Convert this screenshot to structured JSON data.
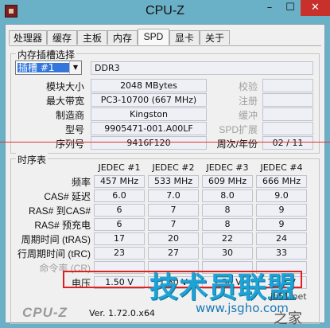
{
  "window": {
    "title": "CPU-Z",
    "min_label": "–",
    "max_label": "☐",
    "close_label": "✕"
  },
  "tabs": [
    {
      "label": "处理器"
    },
    {
      "label": "缓存"
    },
    {
      "label": "主板"
    },
    {
      "label": "内存"
    },
    {
      "label": "SPD",
      "active": true
    },
    {
      "label": "显卡"
    },
    {
      "label": "关于"
    }
  ],
  "slot_group": {
    "title": "内存插槽选择",
    "slot_select": "插槽 #1",
    "type": "DDR3",
    "rows": [
      {
        "label": "模块大小",
        "value": "2048 MBytes",
        "right_label": "校验",
        "right_value": ""
      },
      {
        "label": "最大带宽",
        "value": "PC3-10700 (667 MHz)",
        "right_label": "注册",
        "right_value": ""
      },
      {
        "label": "制造商",
        "value": "Kingston",
        "right_label": "缓冲",
        "right_value": ""
      },
      {
        "label": "型号",
        "value": "9905471-001.A00LF",
        "right_label": "SPD扩展",
        "right_value": ""
      },
      {
        "label": "序列号",
        "value": "9416F120",
        "right_label": "周次/年份",
        "right_value": "02 / 11"
      }
    ]
  },
  "timing_group": {
    "title": "时序表",
    "columns": [
      "JEDEC #1",
      "JEDEC #2",
      "JEDEC #3",
      "JEDEC #4"
    ],
    "rows": [
      {
        "label": "频率",
        "values": [
          "457 MHz",
          "533 MHz",
          "609 MHz",
          "666 MHz"
        ]
      },
      {
        "label": "CAS# 延迟",
        "values": [
          "6.0",
          "7.0",
          "8.0",
          "9.0"
        ]
      },
      {
        "label": "RAS# 到CAS#",
        "values": [
          "6",
          "7",
          "8",
          "9"
        ]
      },
      {
        "label": "RAS# 预充电",
        "values": [
          "6",
          "7",
          "8",
          "9"
        ]
      },
      {
        "label": "周期时间 (tRAS)",
        "values": [
          "17",
          "20",
          "22",
          "24"
        ]
      },
      {
        "label": "行周期时间 (tRC)",
        "values": [
          "23",
          "27",
          "30",
          "33"
        ]
      },
      {
        "label": "命令率 (CR)",
        "values": [
          "",
          "",
          "",
          ""
        ],
        "gray": true
      },
      {
        "label": "电压",
        "values": [
          "1.50 V",
          "1.50 V",
          "1.50 V",
          "1.50 V"
        ]
      }
    ]
  },
  "footer": {
    "brand": "CPU-Z",
    "version": "Ver. 1.72.0.x64"
  },
  "watermark": {
    "main": "技术员联盟",
    "url": "www.jsgho.com",
    "small": "jb51.net",
    "zhi": "之家"
  },
  "colors": {
    "titlebar": "#6ab0c6",
    "close": "#c7302b",
    "highlight": "#e02020",
    "watermark": "#1ea3d6"
  }
}
